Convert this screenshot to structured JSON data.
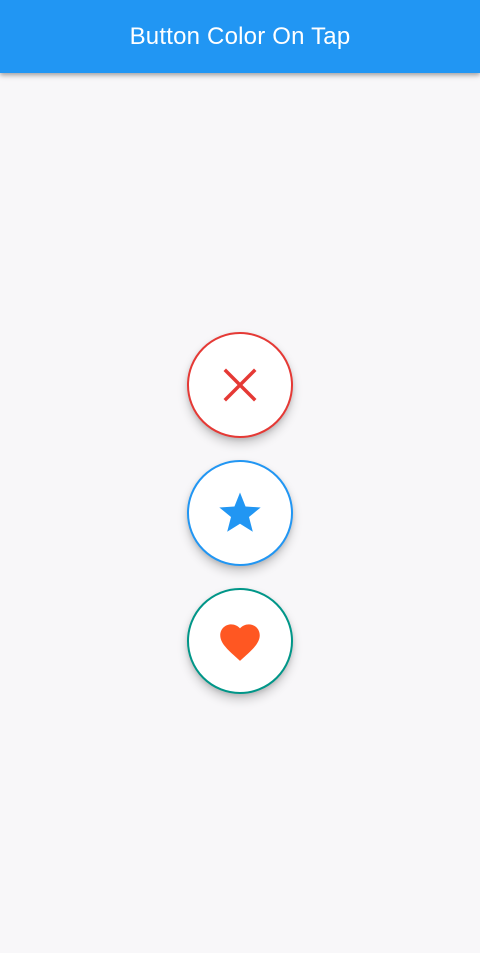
{
  "app_bar": {
    "title": "Button Color On Tap",
    "color": "#2196f3"
  },
  "buttons": [
    {
      "icon": "close-icon",
      "border_color": "#e53935",
      "icon_color": "#e53935"
    },
    {
      "icon": "star-icon",
      "border_color": "#2196f3",
      "icon_color": "#2196f3"
    },
    {
      "icon": "heart-icon",
      "border_color": "#009688",
      "icon_color": "#ff5722"
    }
  ]
}
